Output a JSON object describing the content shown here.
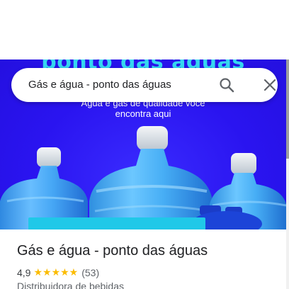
{
  "search": {
    "query": "Gás e água - ponto das águas"
  },
  "hero": {
    "headline": "ponto das águas",
    "subtitle_line1": "Água e gás de qualidade você",
    "subtitle_line2": "encontra aqui"
  },
  "place": {
    "name": "Gás e água - ponto das águas",
    "rating": "4,9",
    "stars": "★★★★★",
    "review_count": "(53)",
    "category": "Distribuidora de bebidas"
  },
  "icons": {
    "search": "search-icon",
    "close": "close-icon"
  },
  "colors": {
    "hero_background": "#2a14f0",
    "headline": "#35d7f0",
    "star": "#fbbc04",
    "text_primary": "#202124",
    "text_secondary": "#5f6368"
  }
}
